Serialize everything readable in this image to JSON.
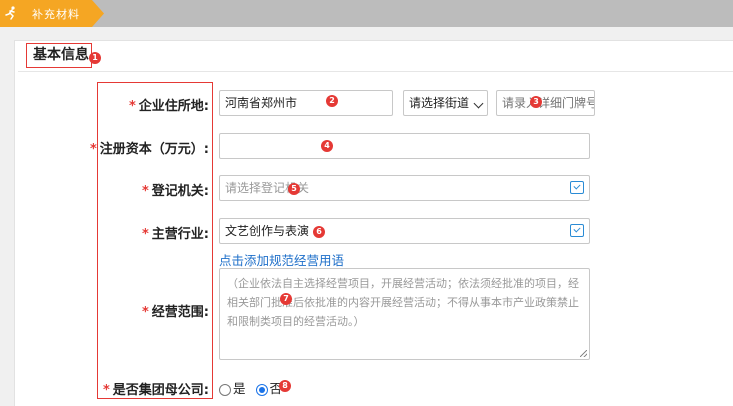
{
  "step_bar": {
    "step_label": "补充材料"
  },
  "section": {
    "title": "基本信息",
    "badge": "1"
  },
  "form": {
    "address": {
      "label": "企业住所地:",
      "value": "河南省郑州市",
      "badge": "2",
      "street_select": "请选择街道",
      "detail_placeholder": "请录入详细门牌号,楼",
      "detail_badge": "3"
    },
    "capital": {
      "label": "注册资本（万元）:",
      "value": "",
      "badge": "4"
    },
    "authority": {
      "label": "登记机关:",
      "placeholder": "请选择登记机关",
      "badge": "5"
    },
    "industry": {
      "label": "主营行业:",
      "value": "文艺创作与表演",
      "badge": "6"
    },
    "scope": {
      "label": "经营范围:",
      "link": "点击添加规范经营用语",
      "placeholder": "（企业依法自主选择经营项目，开展经营活动；依法须经批准的项目，经相关部门批准后依批准的内容开展经营活动；不得从事本市产业政策禁止和限制类项目的经营活动。）",
      "badge": "7"
    },
    "group_company": {
      "label": "是否集团母公司:",
      "options": [
        "是",
        "否"
      ],
      "selected": "否",
      "badge": "8"
    }
  },
  "colors": {
    "accent": "#f5a623",
    "required": "#e53935",
    "link": "#1e6fc9"
  }
}
